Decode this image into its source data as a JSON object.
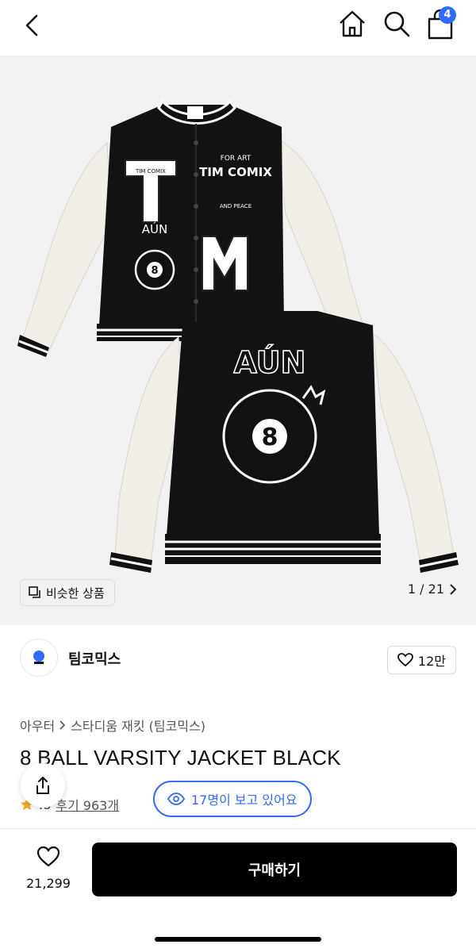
{
  "header": {
    "icons": [
      "back-icon",
      "home-icon",
      "search-icon",
      "cart-icon"
    ],
    "cart_count": "4"
  },
  "gallery": {
    "similar_label": "비슷한 상품",
    "pager": "1 / 21",
    "colors": {
      "bg": "#f2f2f2",
      "wool": "#111111",
      "leather": "#f1efe8",
      "stripe": "#ffffff"
    },
    "patches": {
      "front_chest": "TIM COMIX",
      "front_text_1": "FOR ART",
      "front_text_2": "AND PEACE",
      "brand_script": "AÚN",
      "ball": "8"
    }
  },
  "brand": {
    "name": "팀코믹스",
    "likes": "12만"
  },
  "product": {
    "breadcrumb": [
      "아우터",
      "스타디움 재킷 (팀코믹스)"
    ],
    "title": "8 BALL VARSITY JACKET BLACK",
    "rating": ".8",
    "reviews": "후기 963개",
    "viewers": "17명이 보고 있어요"
  },
  "footer": {
    "wish_count": "21,299",
    "buy_label": "구매하기"
  },
  "accent": "#2f6bff"
}
